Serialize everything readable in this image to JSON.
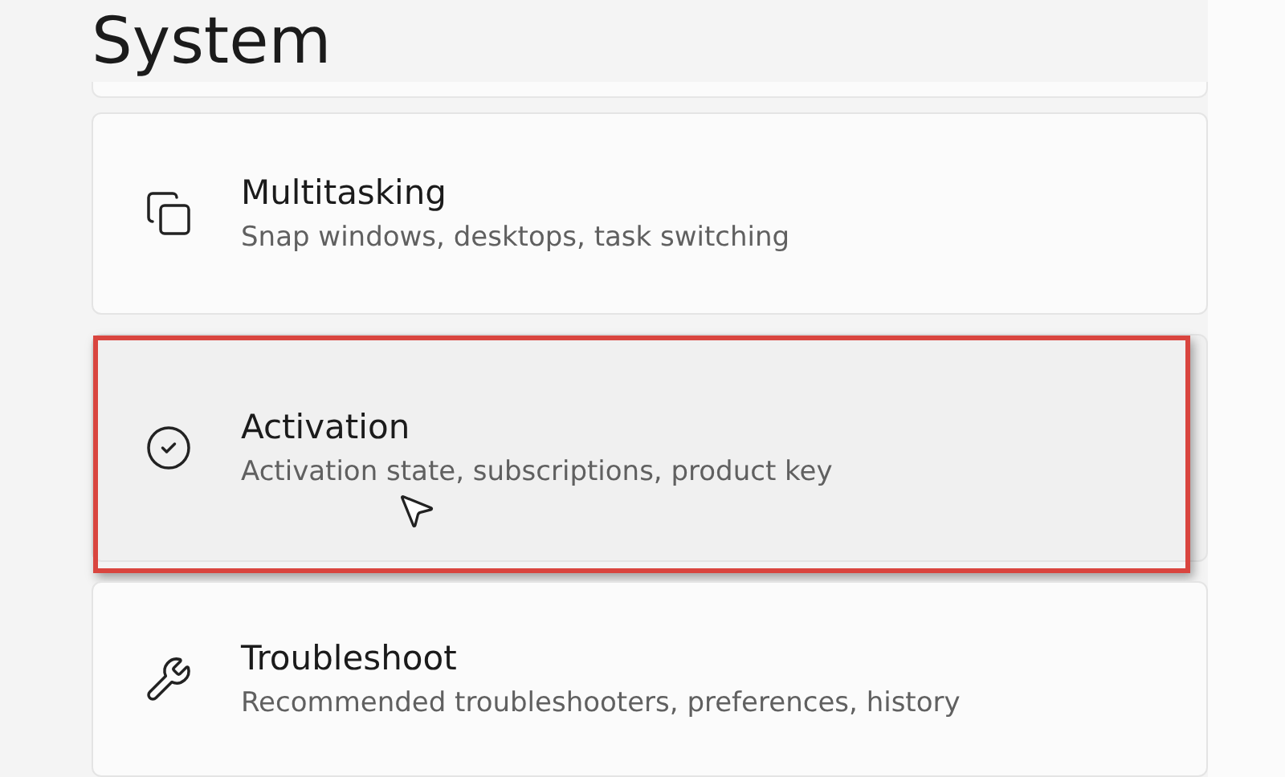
{
  "page_title": "System",
  "items": [
    {
      "kind": "multitasking",
      "title": "Multitasking",
      "subtitle": "Snap windows, desktops, task switching",
      "highlighted": false
    },
    {
      "kind": "activation",
      "title": "Activation",
      "subtitle": "Activation state, subscriptions, product key",
      "highlighted": true
    },
    {
      "kind": "troubleshoot",
      "title": "Troubleshoot",
      "subtitle": "Recommended troubleshooters, preferences, history",
      "highlighted": false
    }
  ]
}
